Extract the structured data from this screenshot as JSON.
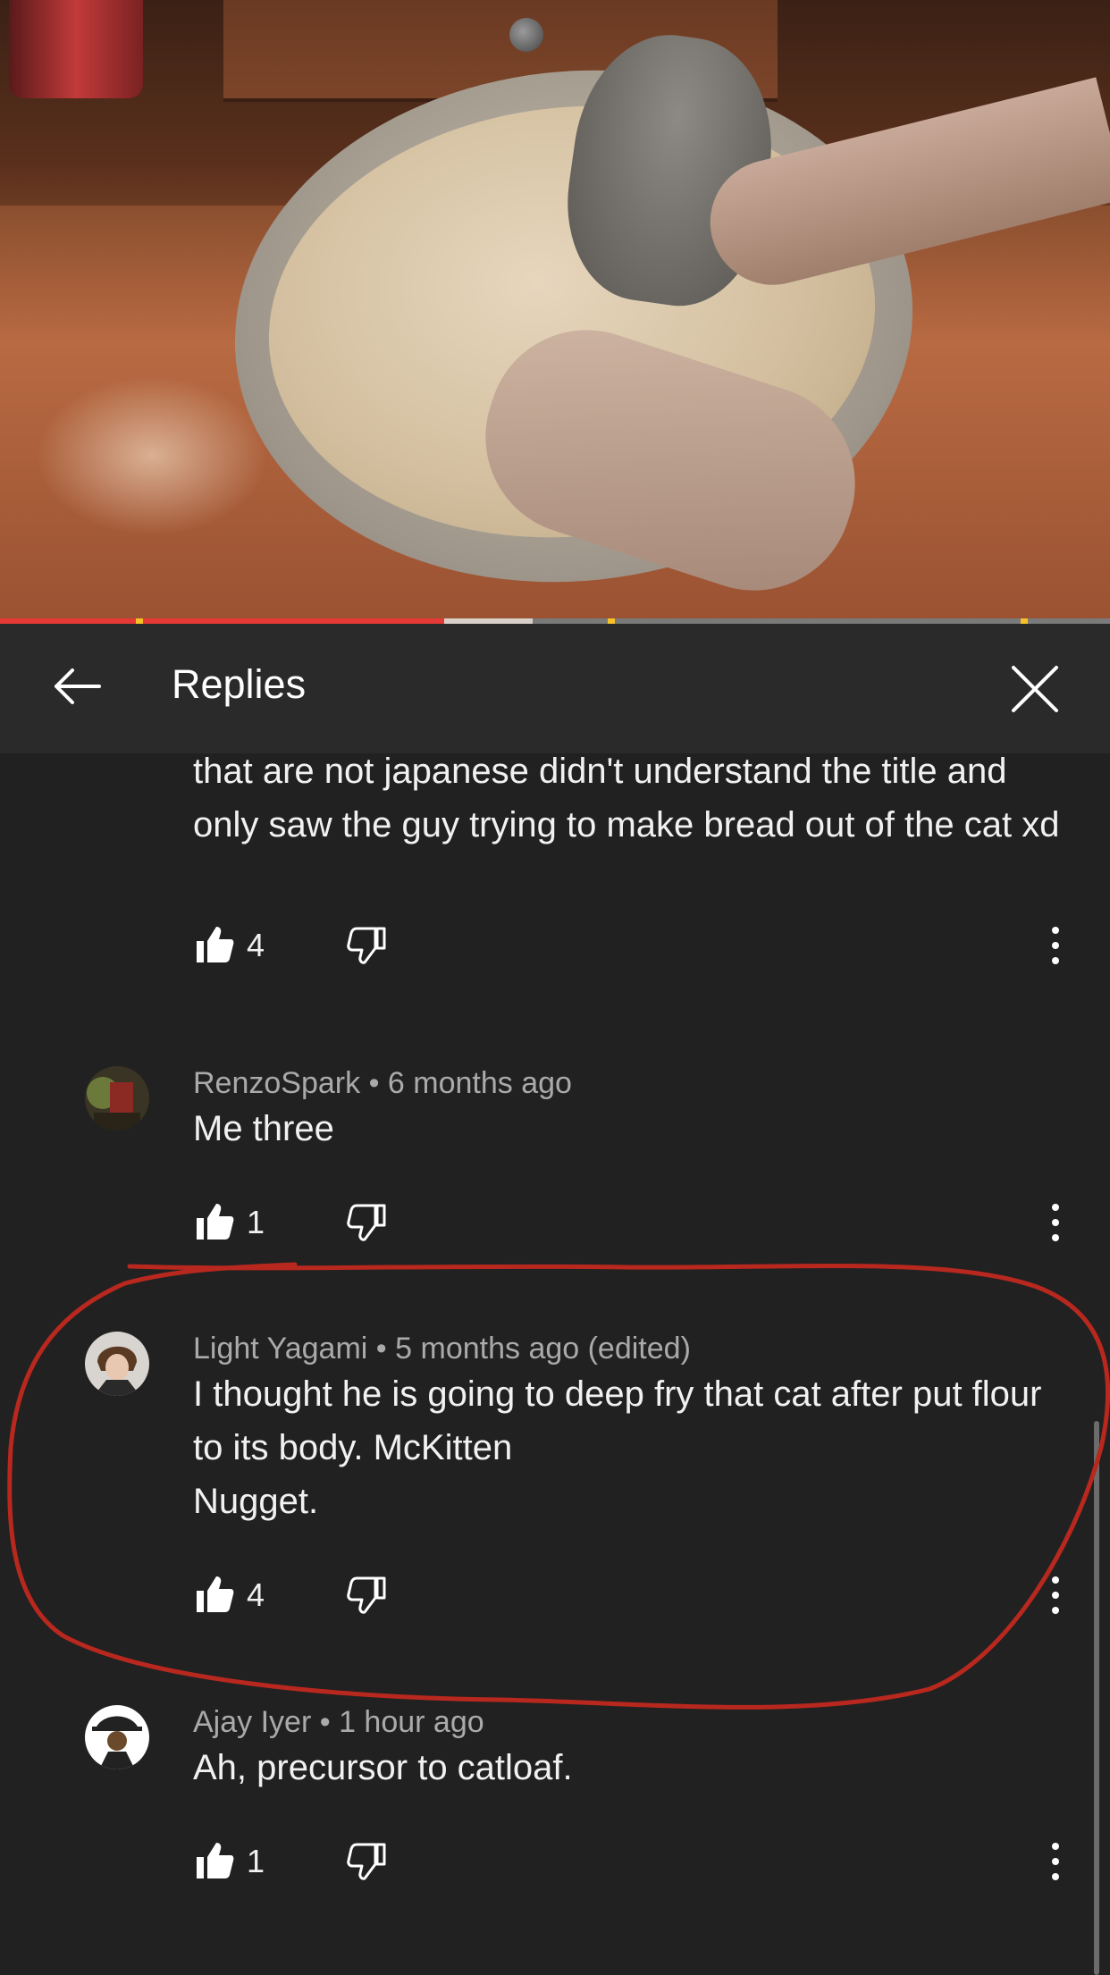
{
  "video": {
    "progress_percent": 40,
    "buffer_percent": 48
  },
  "header": {
    "title": "Replies",
    "back_icon": "arrow-left-icon",
    "close_icon": "close-icon"
  },
  "comments": [
    {
      "author": "",
      "time": "",
      "text": "that are not japanese didn't understand the title and only saw the guy trying to make bread out of the cat xd",
      "likes": "4"
    },
    {
      "author": "RenzoSpark",
      "time": "6 months ago",
      "text": "Me three",
      "likes": "1"
    },
    {
      "author": "Light Yagami",
      "time": "5 months ago (edited)",
      "text": "I thought he is going to deep fry that cat after put flour to its body. McKitten\nNugget.",
      "likes": "4"
    },
    {
      "author": "Ajay Iyer",
      "time": "1 hour ago",
      "text": "Ah, precursor to catloaf.",
      "likes": "1"
    }
  ],
  "meta_separator": "•",
  "colors": {
    "background": "#212121",
    "header": "#2a2a2a",
    "progress": "#e53935",
    "annotation": "#b8281e"
  }
}
